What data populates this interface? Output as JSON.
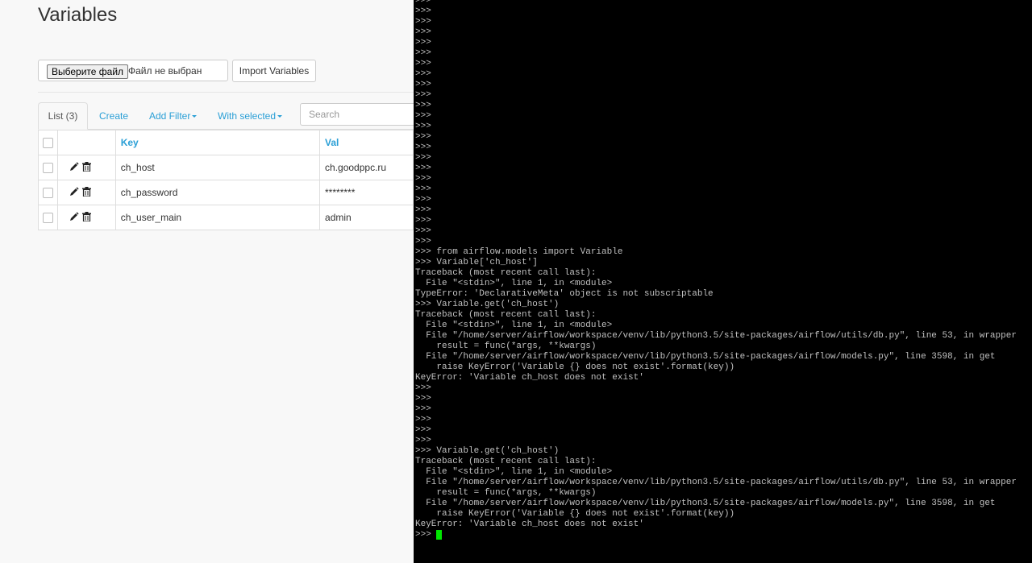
{
  "page": {
    "title": "Variables"
  },
  "upload": {
    "choose_file_label": "Выберите файл",
    "file_status": "Файл не выбран",
    "import_label": "Import Variables"
  },
  "tabs": {
    "list_label": "List (3)",
    "create_label": "Create",
    "add_filter_label": "Add Filter",
    "with_selected_label": "With selected"
  },
  "search": {
    "placeholder": "Search"
  },
  "table": {
    "headers": {
      "key": "Key",
      "val": "Val"
    },
    "rows": [
      {
        "key": "ch_host",
        "val": "ch.goodppc.ru"
      },
      {
        "key": "ch_password",
        "val": "********"
      },
      {
        "key": "ch_user_main",
        "val": "admin"
      }
    ]
  },
  "terminal": {
    "prompt": ">>>",
    "lines": [
      ">>>",
      ">>>",
      ">>>",
      ">>>",
      ">>>",
      ">>>",
      ">>>",
      ">>>",
      ">>>",
      ">>>",
      ">>>",
      ">>>",
      ">>>",
      ">>>",
      ">>>",
      ">>>",
      ">>>",
      ">>>",
      ">>>",
      ">>>",
      ">>>",
      ">>>",
      ">>>",
      ">>>",
      ">>>",
      ">>>",
      ">>> from airflow.models import Variable",
      ">>> Variable['ch_host']",
      "Traceback (most recent call last):",
      "  File \"<stdin>\", line 1, in <module>",
      "TypeError: 'DeclarativeMeta' object is not subscriptable",
      ">>> Variable.get('ch_host')",
      "Traceback (most recent call last):",
      "  File \"<stdin>\", line 1, in <module>",
      "  File \"/home/server/airflow/workspace/venv/lib/python3.5/site-packages/airflow/utils/db.py\", line 53, in wrapper",
      "    result = func(*args, **kwargs)",
      "  File \"/home/server/airflow/workspace/venv/lib/python3.5/site-packages/airflow/models.py\", line 3598, in get",
      "    raise KeyError('Variable {} does not exist'.format(key))",
      "KeyError: 'Variable ch_host does not exist'",
      ">>>",
      ">>>",
      ">>>",
      ">>>",
      ">>>",
      ">>>",
      ">>> Variable.get('ch_host')",
      "Traceback (most recent call last):",
      "  File \"<stdin>\", line 1, in <module>",
      "  File \"/home/server/airflow/workspace/venv/lib/python3.5/site-packages/airflow/utils/db.py\", line 53, in wrapper",
      "    result = func(*args, **kwargs)",
      "  File \"/home/server/airflow/workspace/venv/lib/python3.5/site-packages/airflow/models.py\", line 3598, in get",
      "    raise KeyError('Variable {} does not exist'.format(key))",
      "KeyError: 'Variable ch_host does not exist'"
    ],
    "cursor_color": "#00e600"
  },
  "colors": {
    "link": "#2a9fd6",
    "terminal_bg": "#000000",
    "terminal_text": "#c0c0c0"
  },
  "icons": {
    "edit": "pencil-icon",
    "delete": "trash-icon"
  }
}
